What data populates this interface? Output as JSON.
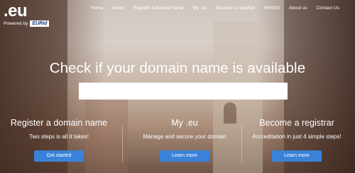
{
  "brand": {
    "logo_text": ".eu",
    "powered_by": "Powered by",
    "partner_logo": "EURid"
  },
  "nav": {
    "items": [
      "Home",
      "News",
      "Register a domain name",
      "My .eu",
      "Become a registrar",
      "WHOIS",
      "About us",
      "Contact Us"
    ]
  },
  "hero": {
    "headline": "Check if your domain name is available",
    "search_value": "",
    "search_placeholder": ""
  },
  "features": [
    {
      "title": "Register a domain name",
      "subtitle": "Two steps is all it takes!",
      "button": "Get started"
    },
    {
      "title": "My .eu",
      "subtitle": "Manage and secure your domain",
      "button": "Learn more"
    },
    {
      "title": "Become a registrar",
      "subtitle": "Accreditation in just 4 simple steps!",
      "button": "Learn more"
    }
  ],
  "colors": {
    "accent": "#3a82d9",
    "text": "#ffffff"
  }
}
